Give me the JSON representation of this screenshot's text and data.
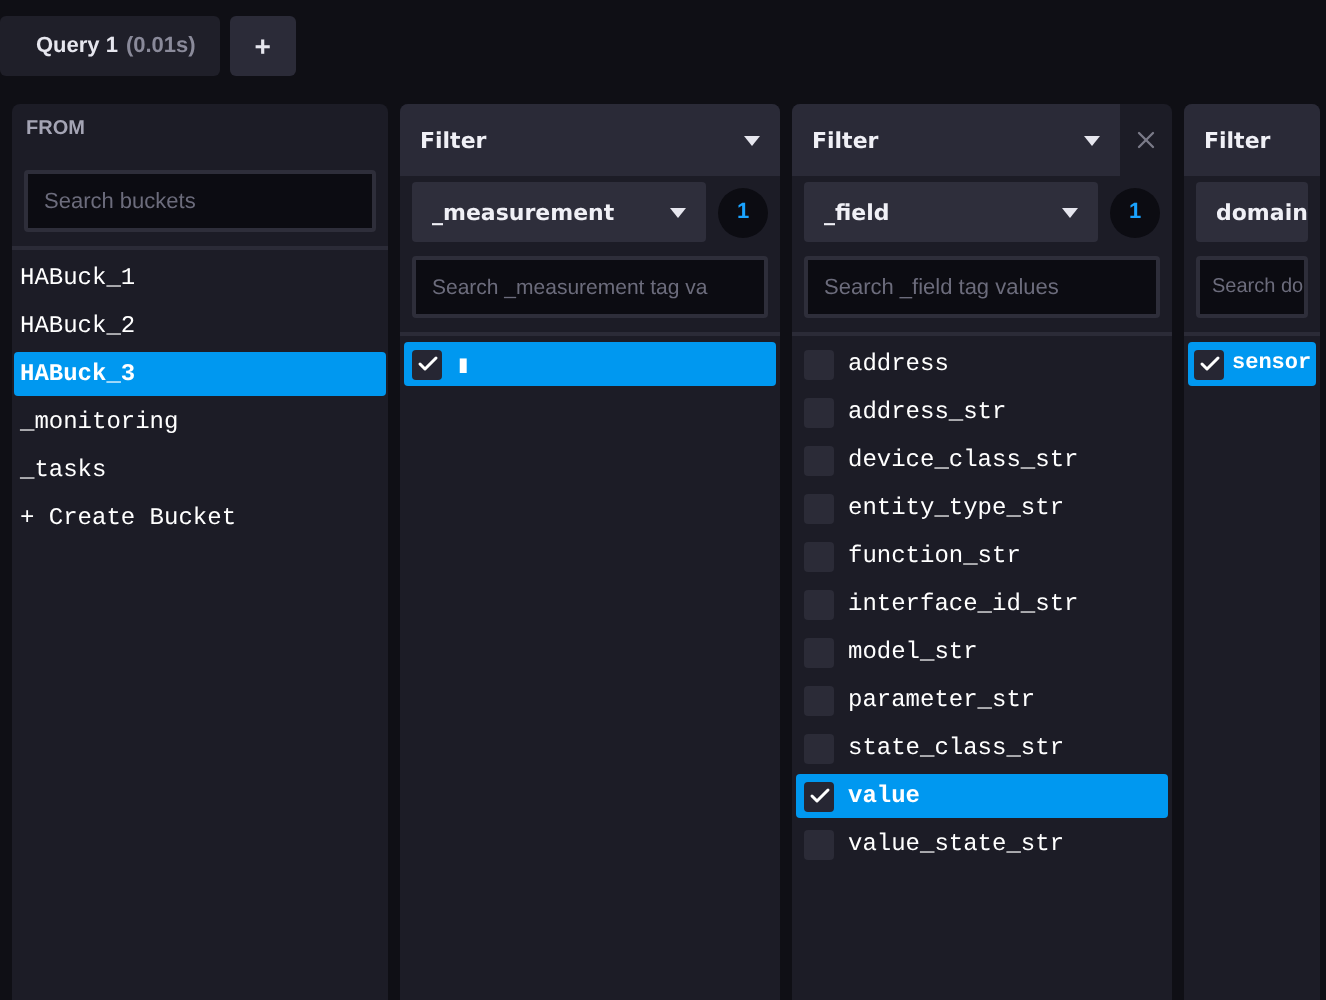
{
  "query_tabs": [
    {
      "label": "Query 1",
      "time": "(0.01s)",
      "selected": true
    }
  ],
  "add_query_button": "+",
  "from": {
    "title": "FROM",
    "search": {
      "placeholder": "Search buckets"
    },
    "buckets": [
      {
        "name": "HABuck_1",
        "selected": false
      },
      {
        "name": "HABuck_2",
        "selected": false
      },
      {
        "name": "HABuck_3",
        "selected": true
      },
      {
        "name": "_monitoring",
        "selected": false
      },
      {
        "name": "_tasks",
        "selected": false
      }
    ],
    "create_bucket": "+ Create Bucket"
  },
  "filters": [
    {
      "title": "Filter",
      "key": "_measurement",
      "count": "1",
      "closable": false,
      "search": {
        "placeholder": "Search _measurement tag va"
      },
      "values": [
        {
          "label": "▮",
          "checked": true
        }
      ]
    },
    {
      "title": "Filter",
      "key": "_field",
      "count": "1",
      "closable": true,
      "search": {
        "placeholder": "Search _field tag values"
      },
      "values": [
        {
          "label": "address",
          "checked": false
        },
        {
          "label": "address_str",
          "checked": false
        },
        {
          "label": "device_class_str",
          "checked": false
        },
        {
          "label": "entity_type_str",
          "checked": false
        },
        {
          "label": "function_str",
          "checked": false
        },
        {
          "label": "interface_id_str",
          "checked": false
        },
        {
          "label": "model_str",
          "checked": false
        },
        {
          "label": "parameter_str",
          "checked": false
        },
        {
          "label": "state_class_str",
          "checked": false
        },
        {
          "label": "value",
          "checked": true
        },
        {
          "label": "value_state_str",
          "checked": false
        }
      ]
    },
    {
      "title": "Filter",
      "key": "domain",
      "closable": false,
      "search": {
        "placeholder": "Search do"
      },
      "values": [
        {
          "label": "sensor",
          "checked": true
        }
      ]
    }
  ]
}
